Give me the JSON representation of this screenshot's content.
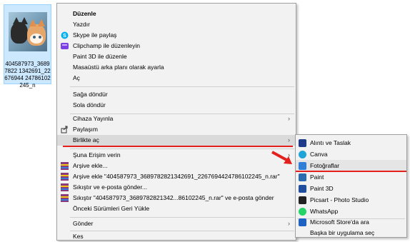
{
  "file": {
    "name": "404587973_3689782821342691_2267694424786102245_n",
    "name_display": "404587973_36897822 1342691_22676944 24786102245_n"
  },
  "menu": {
    "items": [
      {
        "label": "Düzenle"
      },
      {
        "label": "Yazdır"
      },
      {
        "label": "Skype ile paylaş",
        "icon": "skype-icon"
      },
      {
        "label": "Clipchamp ile düzenleyin",
        "icon": "clipchamp-icon"
      },
      {
        "label": "Paint 3D ile düzenle"
      },
      {
        "label": "Masaüstü arka planı olarak ayarla"
      },
      {
        "label": "Aç"
      },
      {
        "label": "Sağa döndür"
      },
      {
        "label": "Sola döndür"
      },
      {
        "label": "Cihaza Yayınla"
      },
      {
        "label": "Paylaşım",
        "icon": "share-icon"
      },
      {
        "label": "Birlikte aç"
      },
      {
        "label": "Şuna Erişim verin"
      },
      {
        "label": "Arşive ekle...",
        "icon": "winrar-icon"
      },
      {
        "label": "Arşive ekle \"404587973_3689782821342691_2267694424786102245_n.rar\"",
        "icon": "winrar-icon"
      },
      {
        "label": "Sıkıştır ve e-posta gönder...",
        "icon": "winrar-icon"
      },
      {
        "label": "Sıkıştır \"404587973_3689782821342...86102245_n.rar\" ve e-posta gönder",
        "icon": "winrar-icon"
      },
      {
        "label": "Önceki Sürümleri Geri Yükle"
      },
      {
        "label": "Gönder"
      },
      {
        "label": "Kes"
      }
    ],
    "arrow": "›"
  },
  "submenu": {
    "items": [
      {
        "label": "Alıntı ve Taslak",
        "icon": "snip-sketch-icon",
        "color": "#1e3a8a"
      },
      {
        "label": "Canva",
        "icon": "canva-icon",
        "color": "#20a4d8"
      },
      {
        "label": "Fotoğraflar",
        "icon": "photos-icon",
        "color": "#2f7fd8"
      },
      {
        "label": "Paint",
        "icon": "paint-icon",
        "color": "#2b6cb0"
      },
      {
        "label": "Paint 3D",
        "icon": "paint3d-icon",
        "color": "#1f4e9e"
      },
      {
        "label": "Picsart - Photo Studio",
        "icon": "picsart-icon",
        "color": "#222222"
      },
      {
        "label": "WhatsApp",
        "icon": "whatsapp-icon",
        "color": "#25d366"
      },
      {
        "label": "Microsoft Store'da ara",
        "icon": "store-icon",
        "color": "#1e62c4"
      },
      {
        "label": "Başka bir uygulama seç"
      }
    ]
  },
  "colors": {
    "annotation_red": "#e3201b",
    "selection_blue": "#cce8ff"
  }
}
